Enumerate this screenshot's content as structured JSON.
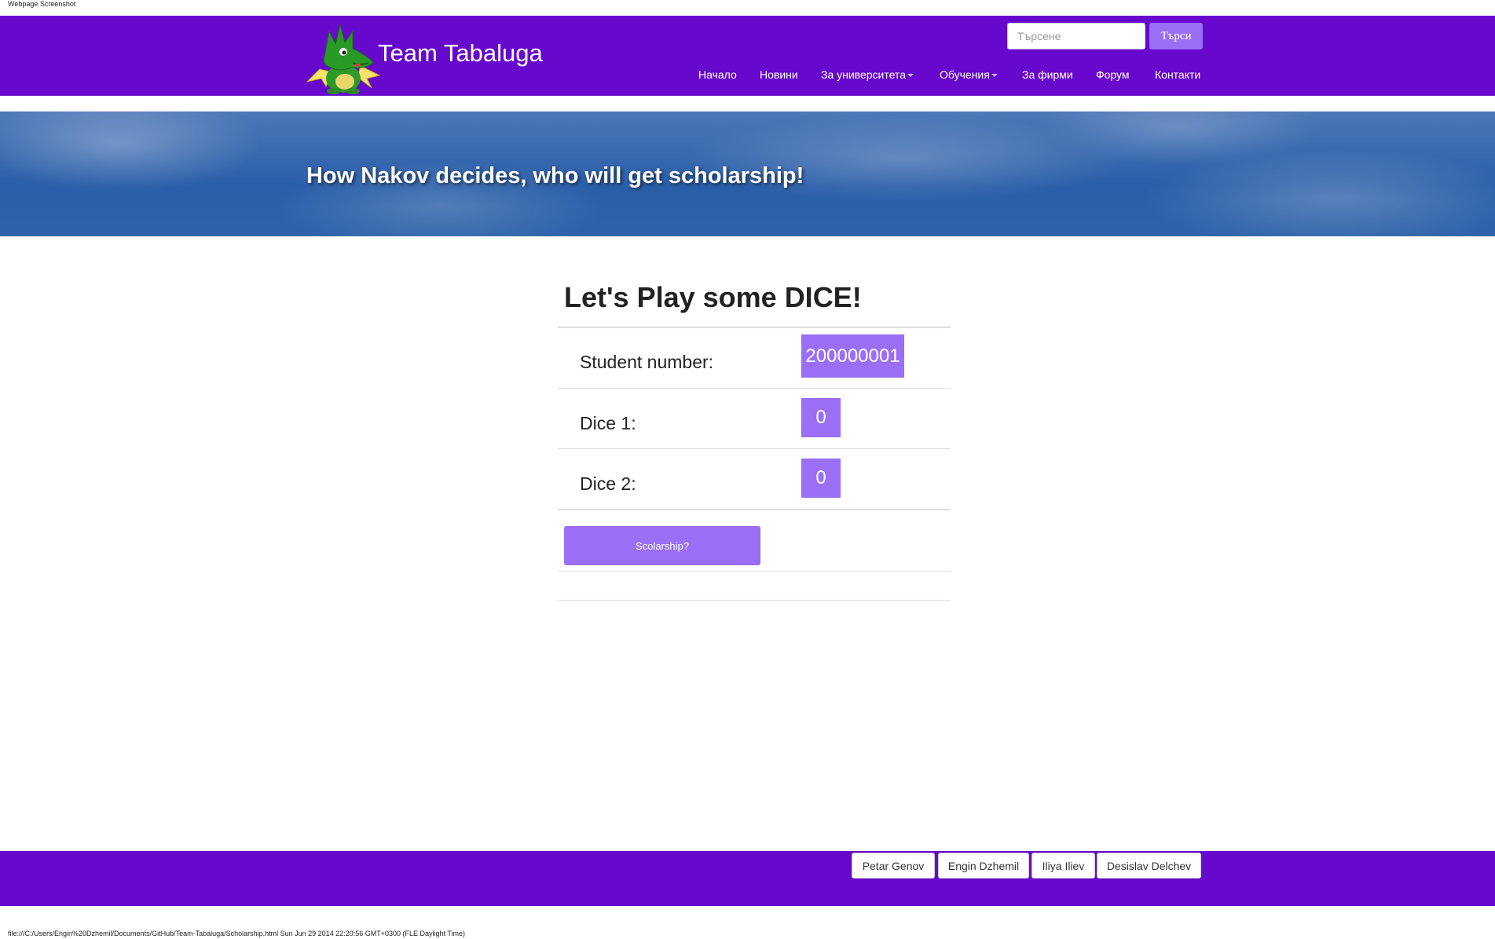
{
  "print": {
    "header": "Webpage Screenshot",
    "footer": "file:///C:/Users/Engin%20Dzhemil/Documents/GitHub/Team-Tabaluga/Scholarship.html Sun Jun 29 2014 22:20:56 GMT+0300 (FLE Daylight Time)"
  },
  "brand": {
    "title": "Team Tabaluga"
  },
  "search": {
    "placeholder": "Търсене",
    "button_label": "Търси"
  },
  "nav": {
    "items": [
      {
        "label": "Начало",
        "dropdown": false
      },
      {
        "label": "Новини",
        "dropdown": false
      },
      {
        "label": "За университета",
        "dropdown": true
      },
      {
        "label": "Обучения",
        "dropdown": true
      },
      {
        "label": "За фирми",
        "dropdown": false
      },
      {
        "label": "Форум",
        "dropdown": false
      },
      {
        "label": "Контакти",
        "dropdown": false
      }
    ]
  },
  "hero": {
    "text": "How Nakov decides, who will get scholarship!"
  },
  "dice": {
    "title": "Let's Play some DICE!",
    "student_label": "Student number:",
    "student_value": "200000001",
    "dice1_label": "Dice 1:",
    "dice1_value": "0",
    "dice2_label": "Dice 2:",
    "dice2_value": "0",
    "button_label": "Scolarship?"
  },
  "footer": {
    "authors": [
      "Petar Genov",
      "Engin Dzhemil",
      "Iliya Iliev",
      "Desislav Delchev"
    ]
  },
  "colors": {
    "brand_purple": "#6609cc",
    "accent_purple": "#9b6ff5",
    "hero_blue": "#2a5ea8"
  }
}
